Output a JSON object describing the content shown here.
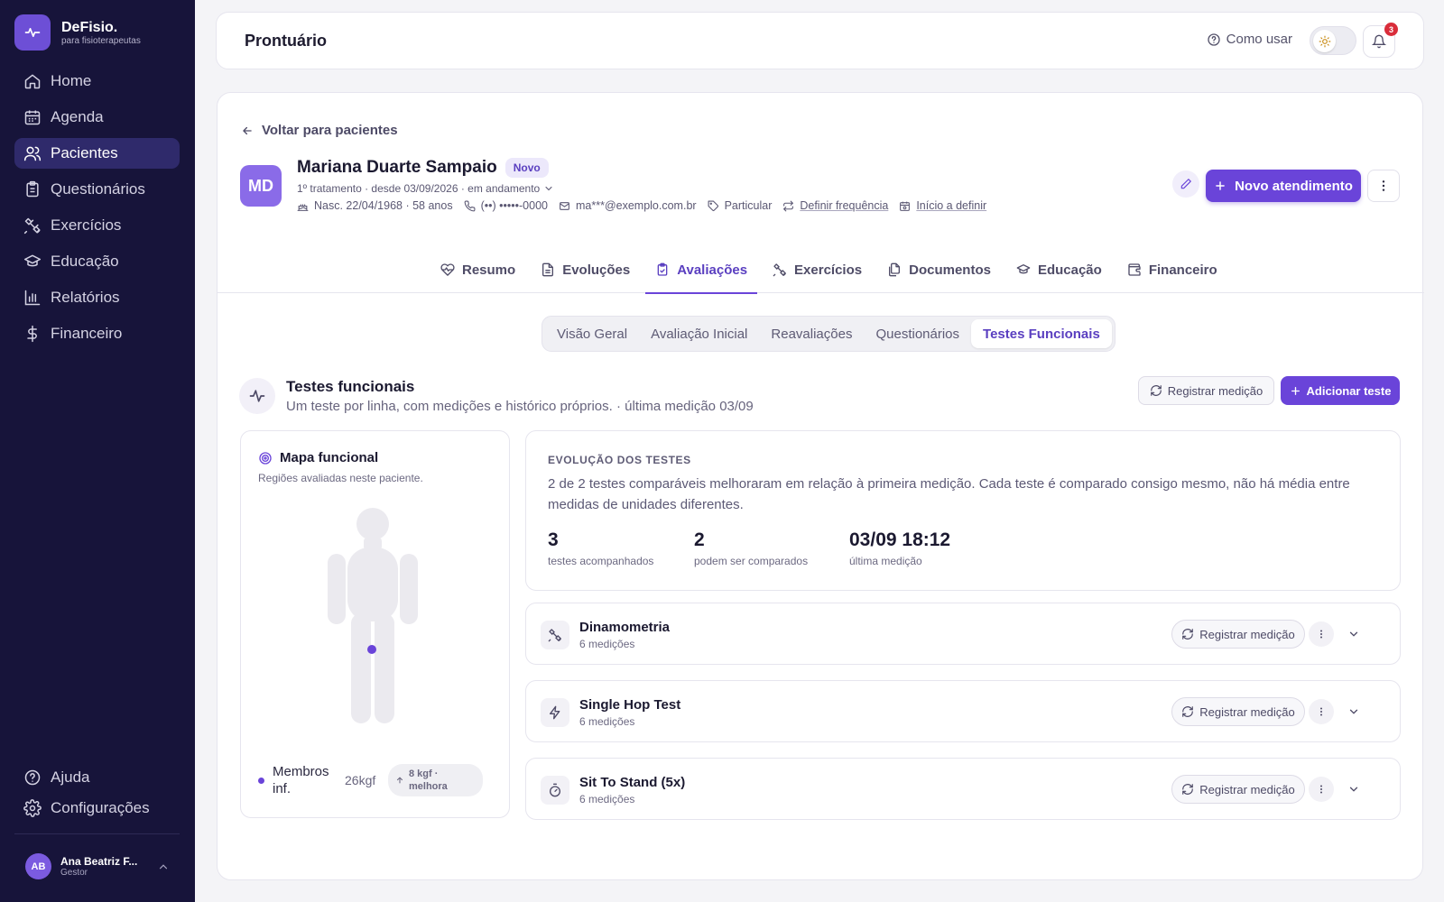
{
  "brand": {
    "name": "DeFisio.",
    "subtitle": "para fisioterapeutas"
  },
  "nav": {
    "items": [
      {
        "label": "Home",
        "icon": "home-icon"
      },
      {
        "label": "Agenda",
        "icon": "calendar-icon"
      },
      {
        "label": "Pacientes",
        "icon": "users-icon",
        "active": true
      },
      {
        "label": "Questionários",
        "icon": "clipboard-icon"
      },
      {
        "label": "Exercícios",
        "icon": "dumbbell-icon"
      },
      {
        "label": "Educação",
        "icon": "graduation-cap-icon"
      },
      {
        "label": "Relatórios",
        "icon": "bar-chart-icon"
      },
      {
        "label": "Financeiro",
        "icon": "dollar-icon"
      }
    ],
    "bottom": [
      {
        "label": "Ajuda",
        "icon": "help-circle-icon"
      },
      {
        "label": "Configurações",
        "icon": "gear-icon"
      }
    ]
  },
  "user": {
    "initials": "AB",
    "name": "Ana Beatriz F...",
    "role": "Gestor"
  },
  "topbar": {
    "title": "Prontuário",
    "help_label": "Como usar",
    "notifications": "3"
  },
  "patient": {
    "back_label": "Voltar para pacientes",
    "initials": "MD",
    "name": "Mariana Duarte Sampaio",
    "badge": "Novo",
    "treatment": "1º tratamento · desde 03/09/2026 · em andamento",
    "birth": "Nasc. 22/04/1968 · 58 anos",
    "phone": "(••) •••••-0000",
    "email": "ma***@exemplo.com.br",
    "plan": "Particular",
    "frequency": "Definir frequência",
    "start": "Início a definir",
    "new_button": "Novo atendimento"
  },
  "tabs": [
    {
      "label": "Resumo",
      "icon": "heart-icon"
    },
    {
      "label": "Evoluções",
      "icon": "file-text-icon"
    },
    {
      "label": "Avaliações",
      "icon": "clipboard-check-icon",
      "active": true
    },
    {
      "label": "Exercícios",
      "icon": "dumbbell-icon"
    },
    {
      "label": "Documentos",
      "icon": "files-icon"
    },
    {
      "label": "Educação",
      "icon": "graduation-cap-icon"
    },
    {
      "label": "Financeiro",
      "icon": "wallet-icon"
    }
  ],
  "subtabs": [
    {
      "label": "Visão Geral"
    },
    {
      "label": "Avaliação Inicial"
    },
    {
      "label": "Reavaliações"
    },
    {
      "label": "Questionários"
    },
    {
      "label": "Testes Funcionais",
      "active": true
    }
  ],
  "section": {
    "title": "Testes funcionais",
    "subtitle": "Um teste por linha, com medições e histórico próprios. · última medição 03/09",
    "register_label": "Registrar medição",
    "add_label": "Adicionar teste"
  },
  "map": {
    "title": "Mapa funcional",
    "subtitle": "Regiões avaliadas neste paciente.",
    "legend": {
      "label": "Membros inf.",
      "value": "26kgf",
      "delta": "8 kgf · melhora"
    },
    "accent": "#6a44d9"
  },
  "evolution": {
    "heading": "EVOLUÇÃO DOS TESTES",
    "text": "2 de 2 testes comparáveis melhoraram em relação à primeira medição. Cada teste é comparado consigo mesmo, não há média entre medidas de unidades diferentes.",
    "stats": [
      {
        "value": "3",
        "label": "testes acompanhados"
      },
      {
        "value": "2",
        "label": "podem ser comparados"
      },
      {
        "value": "03/09 18:12",
        "label": "última medição"
      }
    ]
  },
  "tests": [
    {
      "name": "Dinamometria",
      "count": "6 medições",
      "icon": "dumbbell-icon",
      "register_label": "Registrar medição"
    },
    {
      "name": "Single Hop Test",
      "count": "6 medições",
      "icon": "zap-icon",
      "register_label": "Registrar medição"
    },
    {
      "name": "Sit To Stand (5x)",
      "count": "6 medições",
      "icon": "timer-icon",
      "register_label": "Registrar medição"
    }
  ],
  "colors": {
    "sidebar": "#17143a",
    "accent": "#6a44d9",
    "badge": "#d92d3a"
  }
}
